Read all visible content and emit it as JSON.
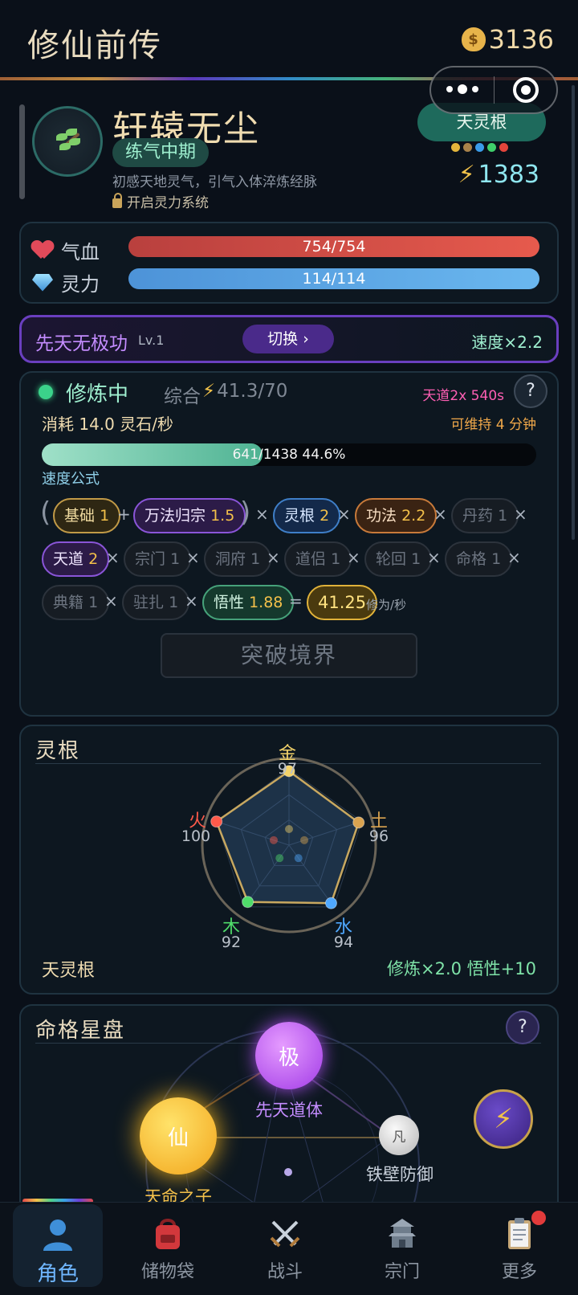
{
  "header": {
    "title": "修仙前传",
    "coins": "3136"
  },
  "profile": {
    "name": "轩辕无尘",
    "realm": "练气中期",
    "description": "初感天地灵气，引气入体淬炼经脉",
    "lock_text": "开启灵力系统",
    "root_tag": "天灵根",
    "element_dot_colors": [
      "#e3b53b",
      "#a8824a",
      "#3a9be8",
      "#3fcf6a",
      "#e3453b"
    ],
    "power": "1383"
  },
  "stats": {
    "hp_label": "气血",
    "hp_value": "754/754",
    "hp_fraction": 1.0,
    "mp_label": "灵力",
    "mp_value": "114/114",
    "mp_fraction": 1.0
  },
  "technique": {
    "name": "先天无极功",
    "level": "Lv.1",
    "switch_label": "切换 ›",
    "speed": "速度×2.2"
  },
  "cultivation": {
    "status": "修炼中",
    "total": "综合",
    "total_value": "41.3/70",
    "heaven_bonus": "天道2x 540s",
    "help": "?",
    "consume": "消耗 14.0 灵石/秒",
    "sustain": "可维持 4 分钟",
    "progress_text": "641/1438  44.6%",
    "progress_fraction": 0.446,
    "formula_label": "速度公式",
    "factors": {
      "base": {
        "name": "基础",
        "value": "1"
      },
      "sect_art": {
        "name": "万法归宗",
        "value": "1.5"
      },
      "root": {
        "name": "灵根",
        "value": "2"
      },
      "technique": {
        "name": "功法",
        "value": "2.2"
      },
      "pill": {
        "name": "丹药",
        "value": "1"
      },
      "heaven": {
        "name": "天道",
        "value": "2"
      },
      "sect": {
        "name": "宗门",
        "value": "1"
      },
      "cave": {
        "name": "洞府",
        "value": "1"
      },
      "partner": {
        "name": "道侣",
        "value": "1"
      },
      "reincarnation": {
        "name": "轮回",
        "value": "1"
      },
      "fate": {
        "name": "命格",
        "value": "1"
      },
      "classics": {
        "name": "典籍",
        "value": "1"
      },
      "station": {
        "name": "驻扎",
        "value": "1"
      },
      "insight": {
        "name": "悟性",
        "value": "1.88"
      }
    },
    "result": "41.25",
    "result_unit": "修为/秒",
    "breakthrough_label": "突破境界"
  },
  "spirit_root": {
    "title": "灵根",
    "elements": {
      "metal": {
        "name": "金",
        "value": 97,
        "color": "#f3d36a"
      },
      "earth": {
        "name": "土",
        "value": 96,
        "color": "#d9a350"
      },
      "water": {
        "name": "水",
        "value": 94,
        "color": "#4fa8ff"
      },
      "wood": {
        "name": "木",
        "value": 92,
        "color": "#4fdc6a"
      },
      "fire": {
        "name": "火",
        "value": 100,
        "color": "#ff5a4a"
      }
    },
    "root_name": "天灵根",
    "bonus": "修炼×2.0  悟性+10"
  },
  "fate": {
    "title": "命格星盘",
    "help": "?",
    "nodes": {
      "ji": {
        "glyph": "极",
        "label": "先天道体"
      },
      "xian": {
        "glyph": "仙",
        "label": "天命之子"
      },
      "fan": {
        "glyph": "凡",
        "label": "铁壁防御"
      }
    }
  },
  "nav": {
    "items": [
      {
        "label": "角色",
        "icon": "character-icon"
      },
      {
        "label": "储物袋",
        "icon": "storage-bag-icon"
      },
      {
        "label": "战斗",
        "icon": "crossed-swords-icon"
      },
      {
        "label": "宗门",
        "icon": "sect-pagoda-icon"
      },
      {
        "label": "更多",
        "icon": "clipboard-icon"
      }
    ]
  }
}
